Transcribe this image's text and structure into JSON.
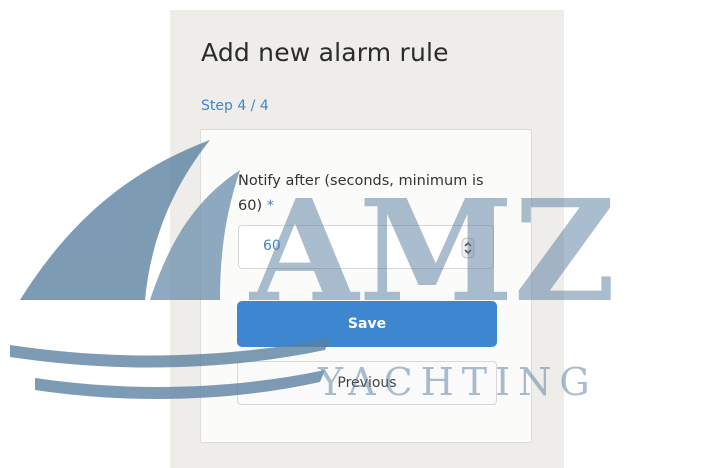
{
  "dialog": {
    "title": "Add new alarm rule",
    "step": "Step 4 / 4"
  },
  "form": {
    "field_label": "Notify after (seconds, minimum is 60)",
    "required_marker": "*",
    "value": "60",
    "save_label": "Save",
    "previous_label": "Previous"
  },
  "watermark": {
    "text_main": "AMZ",
    "text_sub": "YACHTING"
  },
  "colors": {
    "accent": "#3f86d0",
    "watermark": "#5a7fa0"
  },
  "icons": {
    "spinner": "spinner-arrows-icon",
    "logo": "sailboat-logo-icon"
  }
}
